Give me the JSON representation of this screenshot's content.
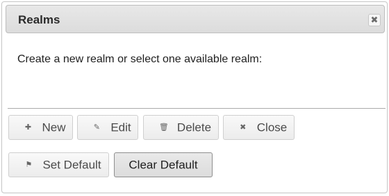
{
  "dialog": {
    "title": "Realms",
    "close_icon_glyph": "✖",
    "message": "Create a new realm or select one available realm:"
  },
  "buttons": {
    "new": {
      "label": "New",
      "icon": "plus-icon",
      "glyph": "✚"
    },
    "edit": {
      "label": "Edit",
      "icon": "pencil-icon",
      "glyph": "✎"
    },
    "delete": {
      "label": "Delete",
      "icon": "trash-icon",
      "glyph": "🗑"
    },
    "close": {
      "label": "Close",
      "icon": "close-icon",
      "glyph": "✖"
    },
    "set_default": {
      "label": "Set Default",
      "icon": "flag-icon",
      "glyph": "⚑"
    },
    "clear_default": {
      "label": "Clear Default"
    }
  },
  "colors": {
    "titlebar_bg": "#dcdcdc",
    "button_bg": "#f3f3f3",
    "active_button_border": "#8e8e8e"
  }
}
